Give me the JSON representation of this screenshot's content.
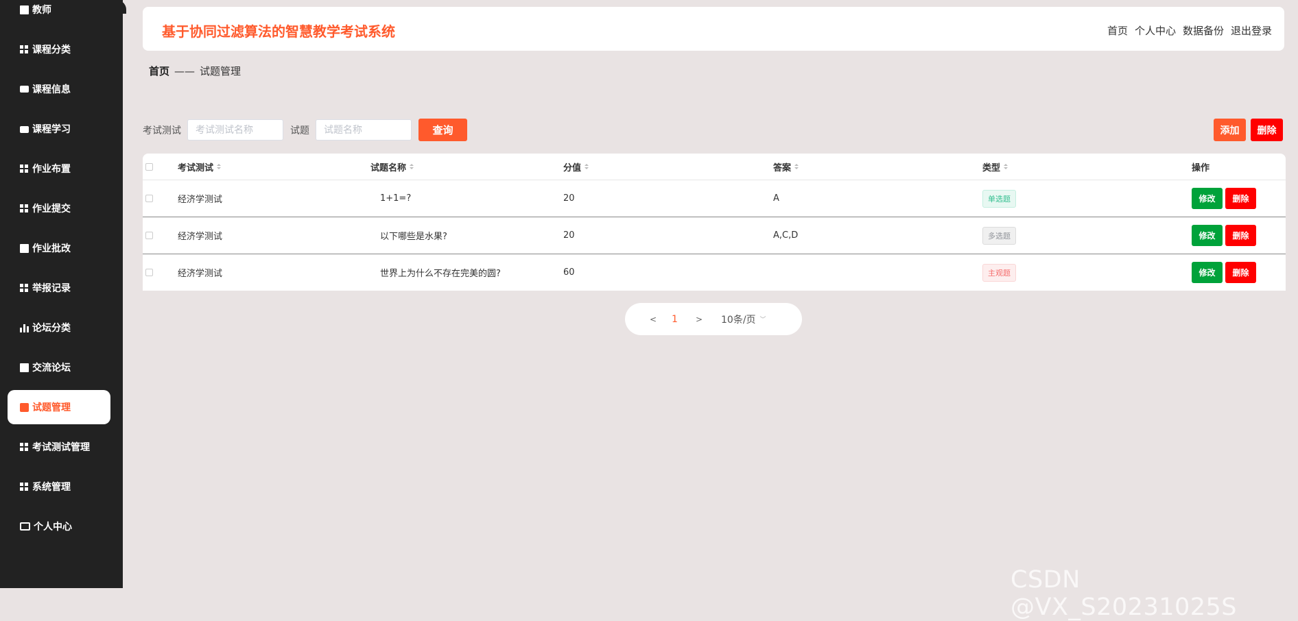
{
  "app": {
    "title": "基于协同过滤算法的智慧教学考试系统"
  },
  "top_nav": [
    "首页",
    "个人中心",
    "数据备份",
    "退出登录"
  ],
  "sidebar": {
    "items": [
      {
        "label": "教师",
        "icon": "book-icon"
      },
      {
        "label": "课程分类",
        "icon": "grid-icon"
      },
      {
        "label": "课程信息",
        "icon": "chat-icon"
      },
      {
        "label": "课程学习",
        "icon": "briefcase-icon"
      },
      {
        "label": "作业布置",
        "icon": "grid-icon"
      },
      {
        "label": "作业提交",
        "icon": "grid-icon"
      },
      {
        "label": "作业批改",
        "icon": "clipboard-icon"
      },
      {
        "label": "举报记录",
        "icon": "table-icon"
      },
      {
        "label": "论坛分类",
        "icon": "bar-chart-icon"
      },
      {
        "label": "交流论坛",
        "icon": "clipboard-icon"
      },
      {
        "label": "试题管理",
        "icon": "paper-icon",
        "active": true
      },
      {
        "label": "考试测试管理",
        "icon": "grid-icon"
      },
      {
        "label": "系统管理",
        "icon": "grid-icon"
      },
      {
        "label": "个人中心",
        "icon": "card-icon"
      }
    ]
  },
  "breadcrumb": {
    "home": "首页",
    "separator": "——",
    "current": "试题管理"
  },
  "search": {
    "exam_label": "考试测试",
    "exam_placeholder": "考试测试名称",
    "question_label": "试题",
    "question_placeholder": "试题名称",
    "query_label": "查询"
  },
  "actions": {
    "add_label": "添加",
    "delete_label": "删除"
  },
  "table": {
    "headers": [
      "考试测试",
      "试题名称",
      "分值",
      "答案",
      "类型",
      "操作"
    ],
    "rows": [
      {
        "exam": "经济学测试",
        "question": "1+1=?",
        "score": "20",
        "answer": "A",
        "type": "单选题"
      },
      {
        "exam": "经济学测试",
        "question": "以下哪些是水果?",
        "score": "20",
        "answer": "A,C,D",
        "type": "多选题"
      },
      {
        "exam": "经济学测试",
        "question": "世界上为什么不存在完美的圆?",
        "score": "60",
        "answer": "",
        "type": "主观题"
      }
    ],
    "edit_label": "修改",
    "delete_label": "删除"
  },
  "pagination": {
    "prev": "<",
    "current_page": "1",
    "next": ">",
    "page_size": "10条/页"
  },
  "watermark": "CSDN @VX_S20231025S",
  "colors": {
    "accent": "#ff5a2c",
    "danger": "#ff0000",
    "success": "#00a23a",
    "sidebar_bg": "#222222",
    "page_bg": "#e9e3e3"
  }
}
